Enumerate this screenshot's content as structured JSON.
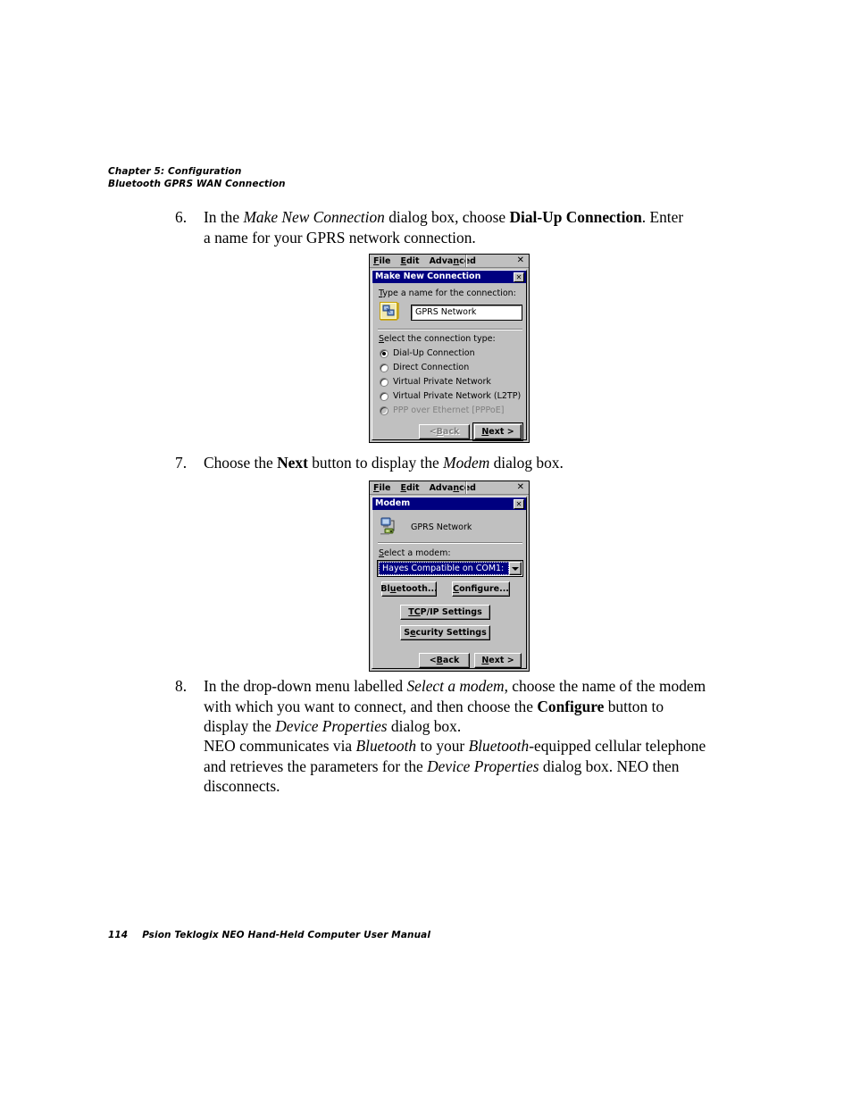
{
  "page_header": {
    "chapter": "Chapter 5:  Configuration",
    "section": "Bluetooth GPRS WAN Connection"
  },
  "page_footer": {
    "page_number": "114",
    "manual_title": "Psion Teklogix NEO Hand-Held Computer User Manual"
  },
  "steps": {
    "step6": {
      "number": "6.",
      "text_1": "In the ",
      "italic_1": "Make New Connection",
      "text_2": " dialog box, choose ",
      "bold_1": "Dial-Up Connection",
      "text_3": ". Enter a name for your GPRS network connection."
    },
    "step7": {
      "number": "7.",
      "text_1": "Choose the ",
      "bold_1": "Next",
      "text_2": " button to display the ",
      "italic_1": "Modem",
      "text_3": " dialog box."
    },
    "step8": {
      "number": "8.",
      "text_1": "In the drop-down menu labelled ",
      "italic_1": "Select a modem",
      "text_2": ", choose the name of the modem with which you want to connect, and then choose the ",
      "bold_1": "Configure",
      "text_3": " button to display the ",
      "italic_2": "Device Properties",
      "text_4": " dialog box."
    }
  },
  "paragraph_neo": {
    "text_1": "NEO communicates via ",
    "italic_1": "Bluetooth",
    "text_2": " to your ",
    "italic_2": "Bluetooth",
    "text_3": "-equipped cellular telephone and retrieves the parameters for the ",
    "italic_3": "Device Properties",
    "text_4": " dialog box. NEO then disconnects."
  },
  "figure_make_new_connection": {
    "menubar": {
      "file": "File",
      "edit": "Edit",
      "advanced": "Advanced",
      "close": "✕"
    },
    "titlebar": {
      "title": "Make New Connection",
      "close": "✕"
    },
    "name_label": "Type a name for the connection:",
    "name_value": "GPRS Network",
    "type_label": "Select the connection type:",
    "options": [
      {
        "label": "Dial-Up Connection",
        "selected": true,
        "disabled": false
      },
      {
        "label": "Direct Connection",
        "selected": false,
        "disabled": false
      },
      {
        "label": "Virtual Private Network",
        "selected": false,
        "disabled": false
      },
      {
        "label": "Virtual Private Network (L2TP)",
        "selected": false,
        "disabled": false
      },
      {
        "label": "PPP over Ethernet [PPPoE]",
        "selected": false,
        "disabled": true
      }
    ],
    "back_button": "< Back",
    "next_button": "Next >"
  },
  "figure_modem": {
    "menubar": {
      "file": "File",
      "edit": "Edit",
      "advanced": "Advanced",
      "close": "✕"
    },
    "titlebar": {
      "title": "Modem",
      "close": "✕"
    },
    "connection_name": "GPRS Network",
    "modem_label": "Select a modem:",
    "modem_value": "Hayes Compatible on COM1:",
    "bluetooth_button": "Bluetooth...",
    "configure_button": "Configure...",
    "tcpip_button": "TCP/IP Settings",
    "security_button": "Security Settings",
    "back_button": "< Back",
    "next_button": "Next >"
  },
  "colors": {
    "titlebar": "#000080",
    "dialog_face": "#c0c0c0",
    "field_bg": "#ffffff",
    "disabled_text": "#808080"
  }
}
